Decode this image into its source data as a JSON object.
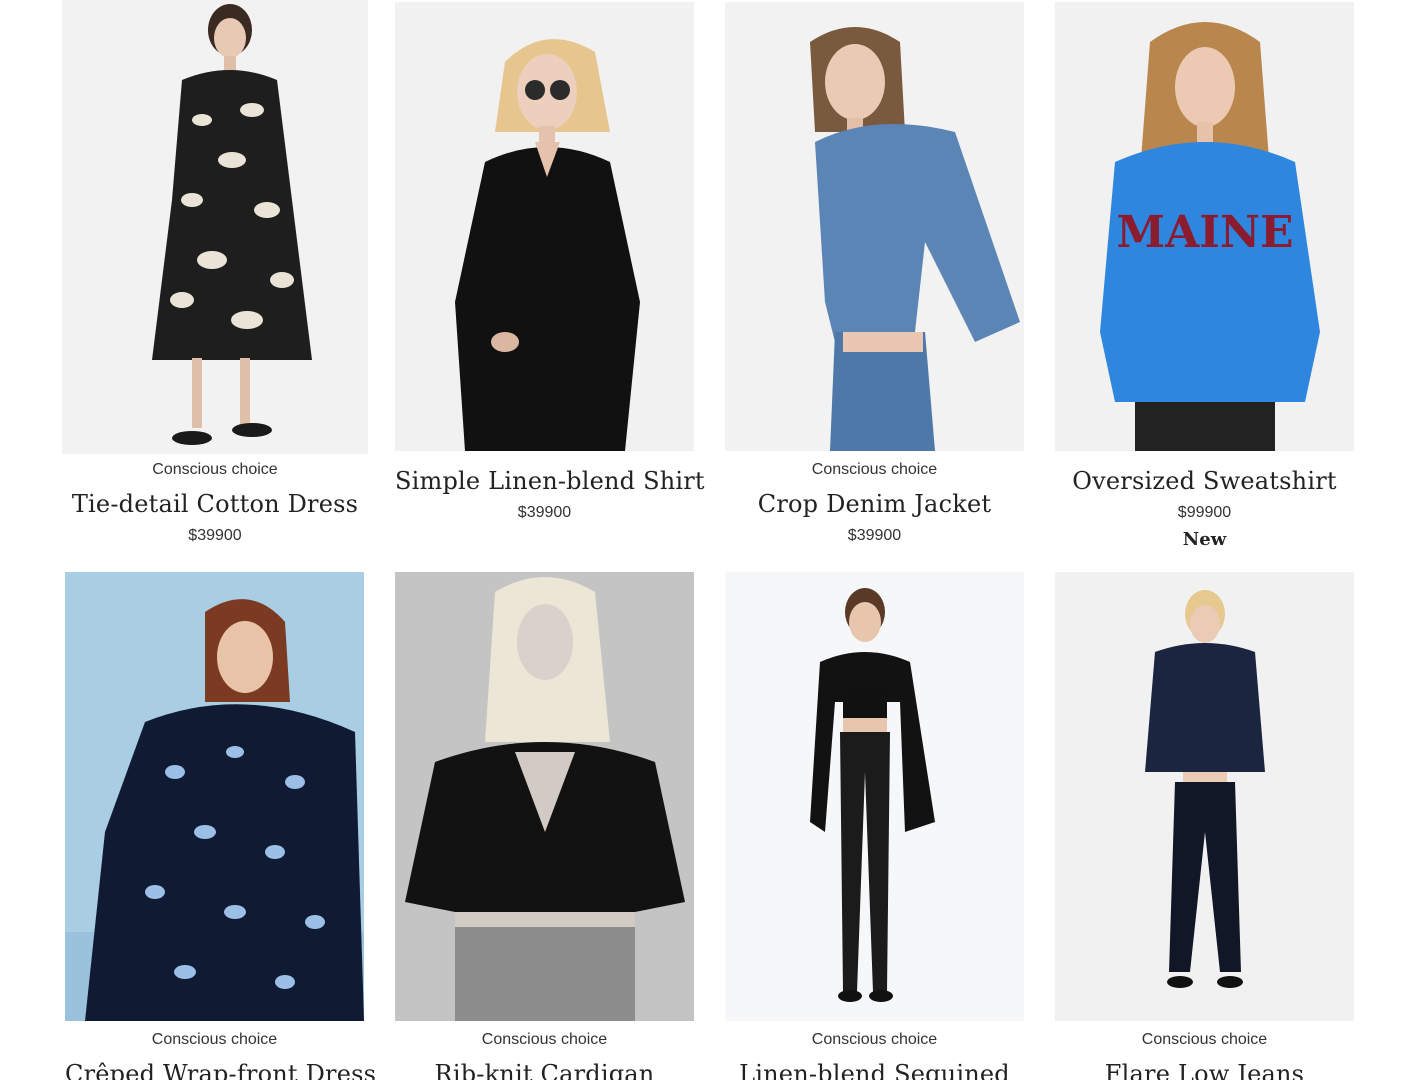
{
  "products": [
    {
      "label": "Conscious choice",
      "name": "Tie-detail Cotton Dress",
      "price": "$39900",
      "badge": null,
      "image": "woman-in-black-white-floral-midi-dress"
    },
    {
      "label": null,
      "name": "Simple Linen-blend Shirt",
      "price": "$39900",
      "badge": null,
      "image": "woman-in-black-linen-shirt-with-sunglasses"
    },
    {
      "label": "Conscious choice",
      "name": "Crop Denim Jacket",
      "price": "$39900",
      "badge": null,
      "image": "woman-in-light-blue-denim-jacket"
    },
    {
      "label": null,
      "name": "Oversized Sweatshirt",
      "price": "$99900",
      "badge": "New",
      "image": "woman-in-blue-maine-sweatshirt"
    },
    {
      "label": "Conscious choice",
      "name": "Crêped Wrap-front Dress",
      "price": null,
      "badge": null,
      "image": "woman-in-navy-printed-wrap-dress"
    },
    {
      "label": "Conscious choice",
      "name": "Rib-knit Cardigan",
      "price": null,
      "badge": null,
      "image": "woman-in-black-rib-knit-cardigan"
    },
    {
      "label": "Conscious choice",
      "name": "Linen-blend Sequined",
      "price": null,
      "badge": null,
      "image": "woman-in-blazer-and-sequined-pants"
    },
    {
      "label": "Conscious choice",
      "name": "Flare Low Jeans",
      "price": null,
      "badge": null,
      "image": "woman-in-navy-blazer-and-flare-jeans"
    }
  ],
  "colors": {
    "page_background": "#ffffff",
    "photo_background_light": "#f1f1f1",
    "photo_background_blue": "#a9cde3",
    "photo_background_grey": "#c9c9c9",
    "text": "#222222"
  }
}
